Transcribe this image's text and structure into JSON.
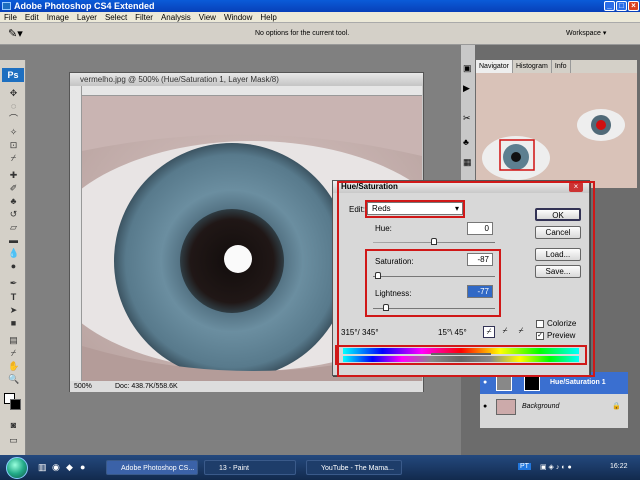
{
  "window": {
    "title": "Adobe Photoshop CS4 Extended"
  },
  "menu": [
    "File",
    "Edit",
    "Image",
    "Layer",
    "Select",
    "Filter",
    "Analysis",
    "View",
    "Window",
    "Help"
  ],
  "options": {
    "message": "No options for the current tool.",
    "workspace": "Workspace"
  },
  "document": {
    "title": "vermelho.jpg @ 500% (Hue/Saturation 1, Layer Mask/8)",
    "zoom": "500%",
    "doc_info": "Doc: 438.7K/558.6K"
  },
  "dialog": {
    "title": "Hue/Saturation",
    "edit_label": "Edit:",
    "edit_value": "Reds",
    "hue_label": "Hue:",
    "hue_value": "0",
    "saturation_label": "Saturation:",
    "saturation_value": "-87",
    "lightness_label": "Lightness:",
    "lightness_value": "-77",
    "ok": "OK",
    "cancel": "Cancel",
    "load": "Load...",
    "save": "Save...",
    "colorize": "Colorize",
    "preview": "Preview",
    "colorize_checked": false,
    "preview_checked": true,
    "range_left": "315°/ 345°",
    "range_right": "15°\\ 45°"
  },
  "panels": {
    "tabs": [
      "Navigator",
      "Histogram",
      "Info"
    ]
  },
  "layers": [
    {
      "name": "Hue/Saturation 1",
      "selected": true
    },
    {
      "name": "Background",
      "selected": false
    }
  ],
  "taskbar": {
    "items": [
      "Adobe Photoshop CS...",
      "13 - Paint",
      "YouTube - The Mama..."
    ],
    "lang": "PT",
    "clock": "16:22"
  }
}
